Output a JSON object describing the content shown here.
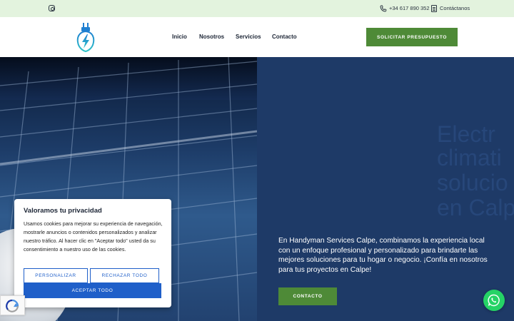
{
  "topbar": {
    "phone": "+34 617 890 352",
    "contact": "Contáctanos",
    "icons": [
      "instagram-icon",
      "phone-icon",
      "document-icon"
    ]
  },
  "header": {
    "logo": "lightning-plug-logo",
    "nav": [
      "Inicio",
      "Nosotros",
      "Servicios",
      "Contacto"
    ],
    "cta": "SOLICITAR PRESUPUESTO"
  },
  "hero": {
    "ghost_lines": [
      "Electr",
      "climati",
      "solucio",
      "en Calp"
    ],
    "text": "En Handyman Services Calpe, combinamos la experiencia local con un enfoque profesional y personalizado para brindarte las mejores soluciones para tu hogar o negocio. ¡Confía en nosotros para tus proyectos en Calpe!",
    "cta": "CONTACTO"
  },
  "cookie": {
    "title": "Valoramos tu privacidad",
    "body": "Usamos cookies para mejorar su experiencia de navegación, mostrarle anuncios o contenidos personalizados y analizar nuestro tráfico. Al hacer clic en \"Aceptar todo\" usted da su consentimiento a nuestro uso de las cookies.",
    "customize": "PERSONALIZAR",
    "reject": "RECHAZAR TODO",
    "accept": "ACEPTAR TODO"
  },
  "colors": {
    "accent_green": "#4e8a37",
    "hero_blue": "#1e3a67",
    "cookie_blue": "#1f5fc9",
    "topbar_bg": "#e3f3de",
    "whatsapp": "#25d366"
  }
}
